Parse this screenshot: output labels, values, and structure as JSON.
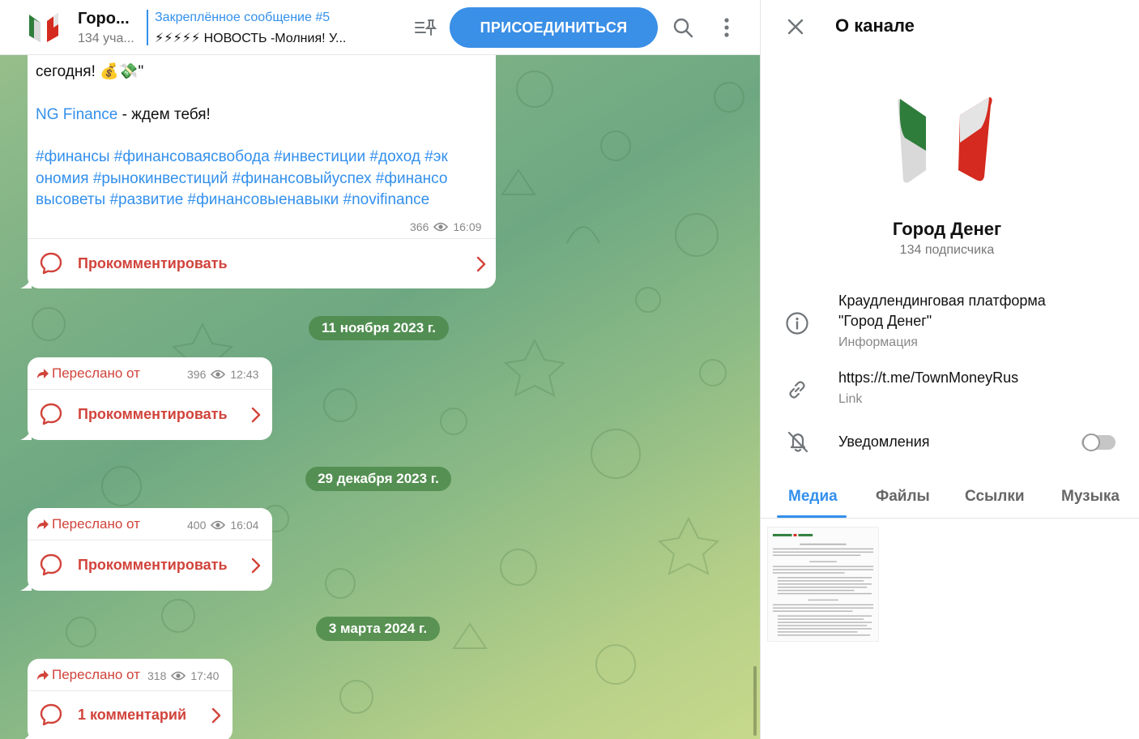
{
  "header": {
    "channel_name": "Горо...",
    "members": "134 уча...",
    "pinned_label": "Закреплённое сообщение #5",
    "pinned_text": "⚡⚡⚡⚡⚡ НОВОСТЬ -Молния! У...",
    "join_label": "ПРИСОЕДИНИТЬСЯ"
  },
  "messages": {
    "post1": {
      "line1": "сегодня! 💰💸\"",
      "link_text": "NG Finance",
      "line2_rest": " - ждем тебя!",
      "hashtags_1": "#финансы #финансоваясвобода #инвестиции #доход #эк",
      "hashtags_2": "ономия #рынокинвестиций #финансовыйуспех #финансо",
      "hashtags_3": "высоветы #развитие #финансовыенавыки #novifinance",
      "views": "366",
      "time": "16:09",
      "comment_label": "Прокомментировать"
    },
    "date1": "11 ноября 2023 г.",
    "fwd1": {
      "forwarded": "Переслано от",
      "views": "396",
      "time": "12:43",
      "comment_label": "Прокомментировать"
    },
    "date2": "29 декабря 2023 г.",
    "fwd2": {
      "forwarded": "Переслано от",
      "views": "400",
      "time": "16:04",
      "comment_label": "Прокомментировать"
    },
    "date3": "3 марта 2024 г.",
    "fwd3": {
      "forwarded": "Переслано от",
      "views": "318",
      "time": "17:40",
      "comment_label": "1 комментарий"
    }
  },
  "panel": {
    "title": "О канале",
    "name": "Город Денег",
    "subscribers": "134 подписчика",
    "description_1": "Краудлендинговая платформа",
    "description_2": "\"Город Денег\"",
    "description_caption": "Информация",
    "link": "https://t.me/TownMoneyRus",
    "link_caption": "Link",
    "notifications": "Уведомления",
    "notifications_enabled": false,
    "tabs": [
      "Медиа",
      "Файлы",
      "Ссылки",
      "Музыка"
    ],
    "active_tab": "Медиа"
  },
  "colors": {
    "accent": "#3390ec",
    "join_button": "#3a8fe6",
    "comment": "#d1433b",
    "logo_green": "#2e7d3a",
    "logo_red": "#d42a1f"
  }
}
